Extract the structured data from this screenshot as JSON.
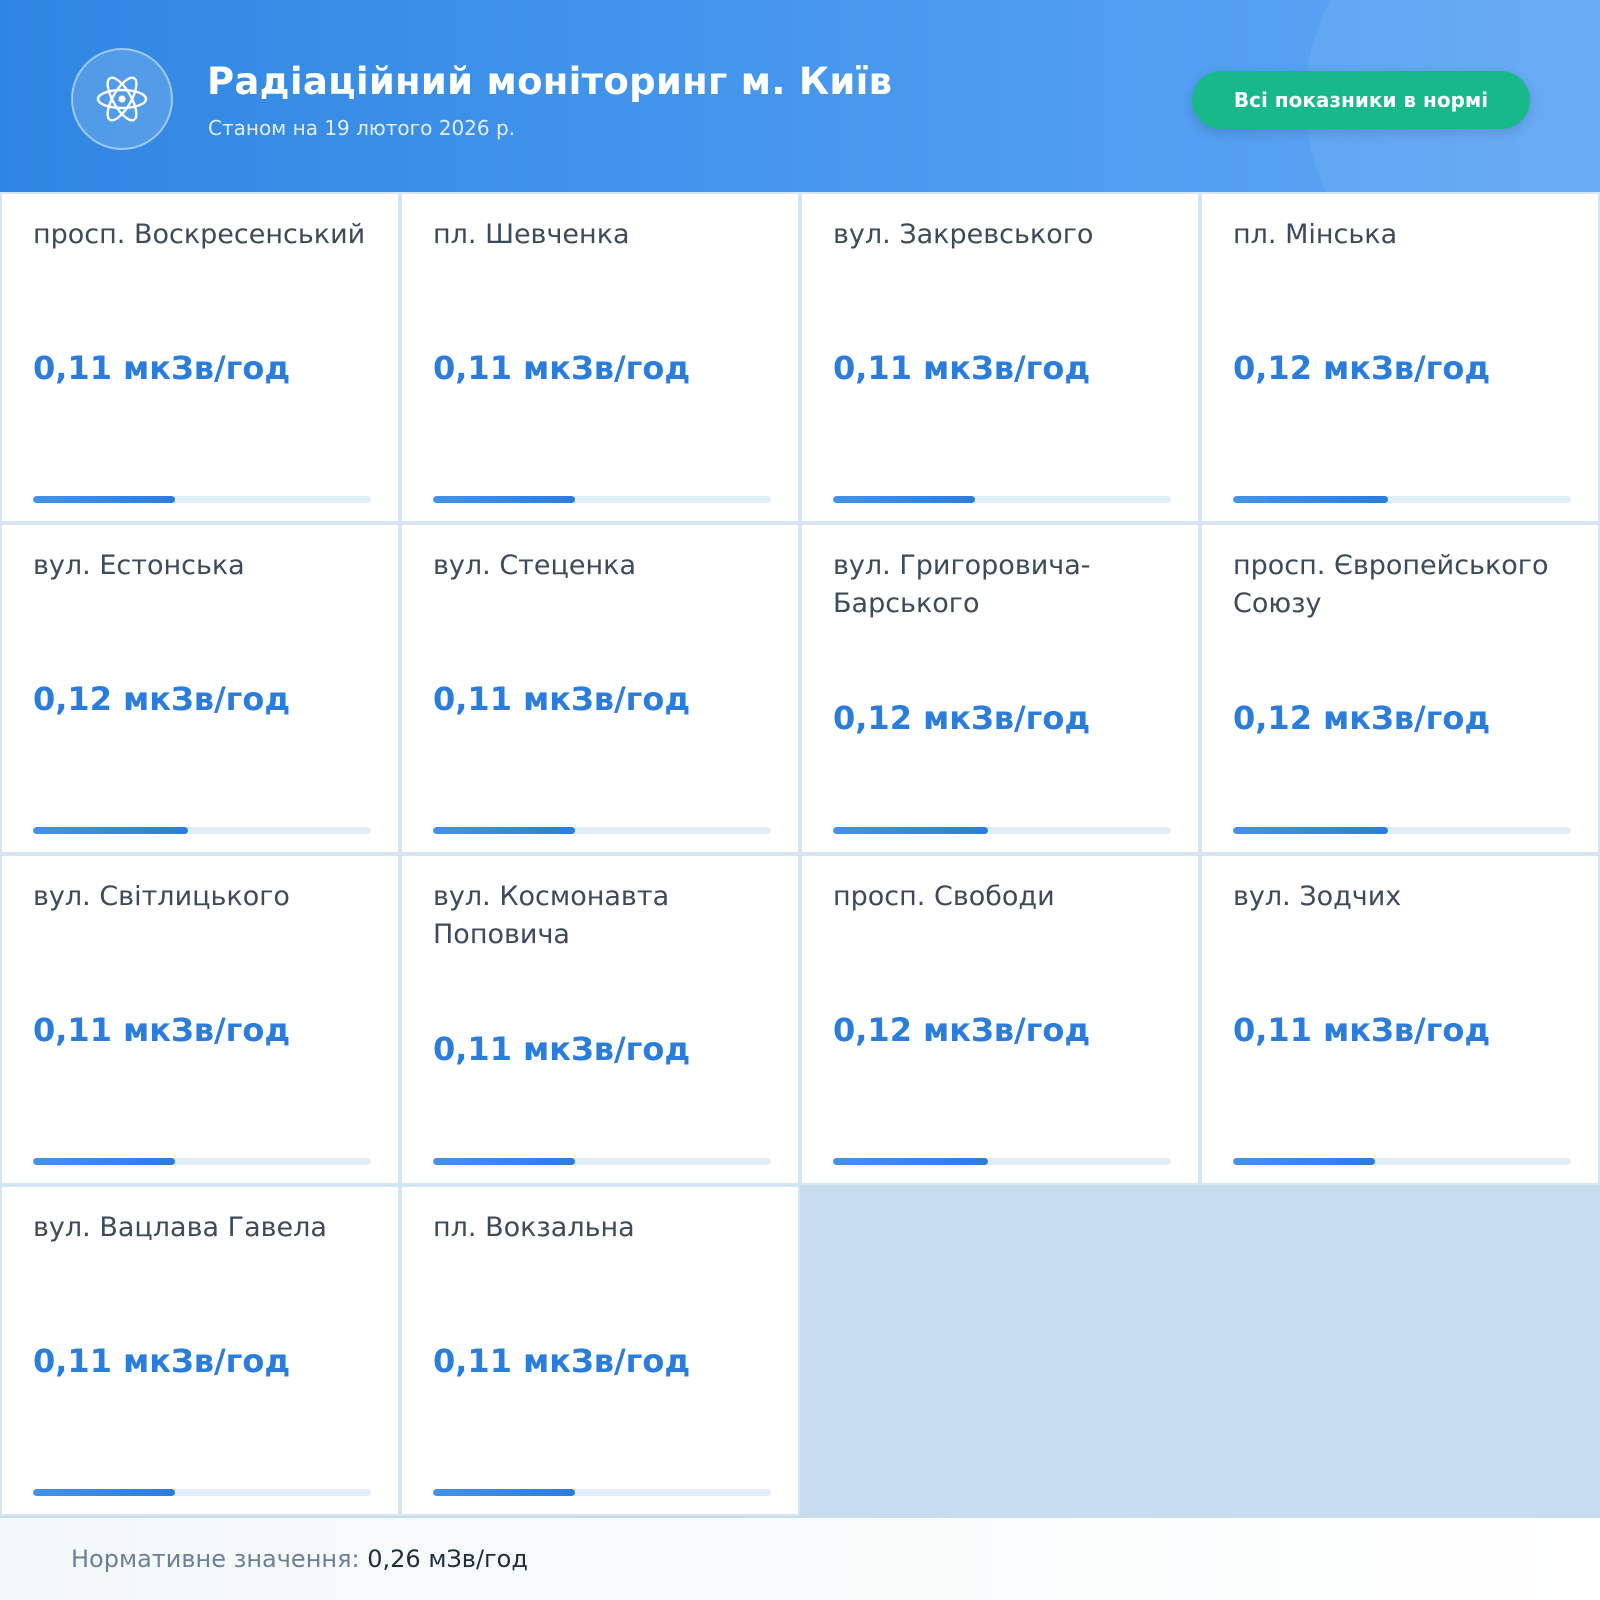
{
  "header": {
    "logo_icon": "atom-icon",
    "title": "Радіаційний моніторинг м. Київ",
    "subtitle": "Станом на 19 лютого 2026 р.",
    "status": "Всі показники в нормі"
  },
  "stations": [
    {
      "location": "просп. Воскресенський",
      "reading": "0,11 мкЗв/год",
      "level": 0.42
    },
    {
      "location": "пл. Шевченка",
      "reading": "0,11 мкЗв/год",
      "level": 0.42
    },
    {
      "location": "вул. Закревського",
      "reading": "0,11 мкЗв/год",
      "level": 0.42
    },
    {
      "location": "пл. Мінська",
      "reading": "0,12 мкЗв/год",
      "level": 0.46
    },
    {
      "location": "вул. Естонська",
      "reading": "0,12 мкЗв/год",
      "level": 0.46
    },
    {
      "location": "вул. Стеценка",
      "reading": "0,11 мкЗв/год",
      "level": 0.42
    },
    {
      "location": "вул. Григоровича-Барського",
      "reading": "0,12 мкЗв/год",
      "level": 0.46
    },
    {
      "location": "просп. Європейського Союзу",
      "reading": "0,12 мкЗв/год",
      "level": 0.46
    },
    {
      "location": "вул. Світлицького",
      "reading": "0,11 мкЗв/год",
      "level": 0.42
    },
    {
      "location": "вул. Космонавта Поповича",
      "reading": "0,11 мкЗв/год",
      "level": 0.42
    },
    {
      "location": "просп. Свободи",
      "reading": "0,12 мкЗв/год",
      "level": 0.46
    },
    {
      "location": "вул. Зодчих",
      "reading": "0,11 мкЗв/год",
      "level": 0.42
    },
    {
      "location": "вул. Вацлава Гавела",
      "reading": "0,11 мкЗв/год",
      "level": 0.42
    },
    {
      "location": "пл. Вокзальна",
      "reading": "0,11 мкЗв/год",
      "level": 0.42
    }
  ],
  "footer": {
    "norm_label": "Нормативне значення:",
    "norm_value": "0,26 мЗв/год"
  },
  "colors": {
    "header_blue": "#2f86e2",
    "accent_blue": "#2b7ddd",
    "ok_green": "#17b88a",
    "text_dark": "#3c4a5c"
  }
}
